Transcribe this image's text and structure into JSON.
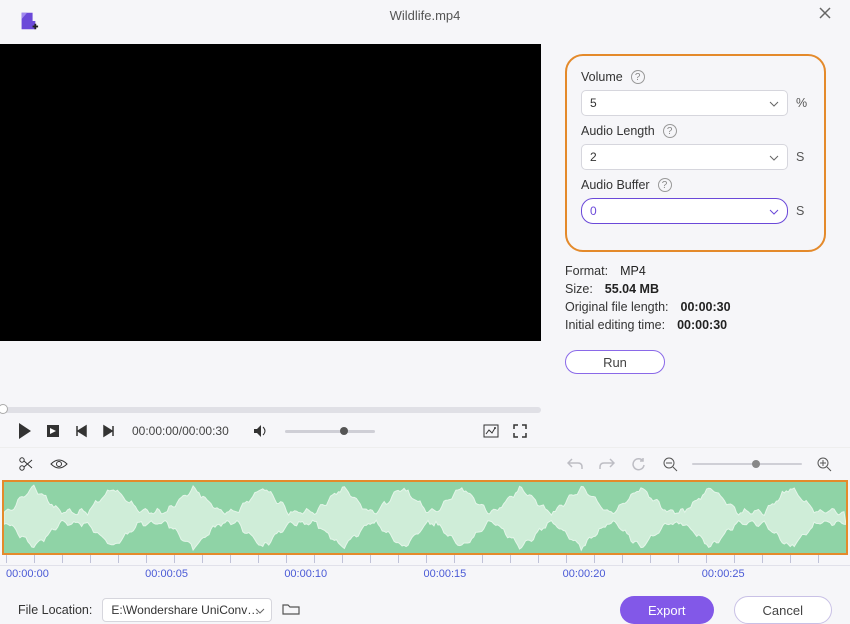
{
  "header": {
    "filename": "Wildlife.mp4"
  },
  "panel": {
    "volume": {
      "label": "Volume",
      "value": "5",
      "unit": "%"
    },
    "audio_length": {
      "label": "Audio Length",
      "value": "2",
      "unit": "S"
    },
    "audio_buffer": {
      "label": "Audio Buffer",
      "value": "0",
      "unit": "S"
    },
    "format": {
      "label": "Format:",
      "value": "MP4"
    },
    "size": {
      "label": "Size:",
      "value": "55.04 MB"
    },
    "orig_len": {
      "label": "Original file length:",
      "value": "00:00:30"
    },
    "init_time": {
      "label": "Initial editing time:",
      "value": "00:00:30"
    },
    "run": "Run"
  },
  "player": {
    "time_current": "00:00:00",
    "time_total": "00:00:30"
  },
  "timeline": {
    "ticks": [
      "00:00:00",
      "00:00:05",
      "00:00:10",
      "00:00:15",
      "00:00:20",
      "00:00:25"
    ]
  },
  "footer": {
    "location_label": "File Location:",
    "path": "E:\\Wondershare UniConverter",
    "export": "Export",
    "cancel": "Cancel"
  }
}
